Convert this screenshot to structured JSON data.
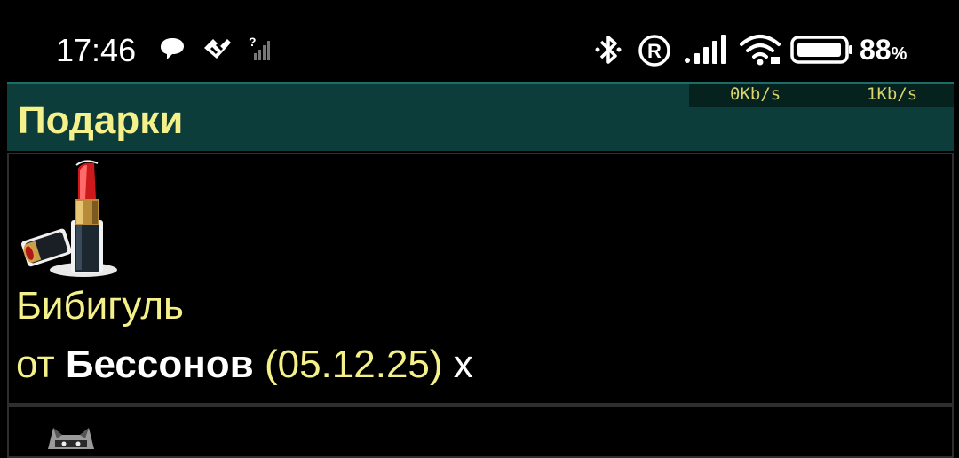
{
  "status_bar": {
    "time": "17:46",
    "battery_percent": "88",
    "battery_unit": "%",
    "icons": [
      "chat-bubble-icon",
      "app-notification-icon",
      "no-signal-sim-icon",
      "bluetooth-icon",
      "registered-icon",
      "signal-icon",
      "wifi-icon",
      "battery-icon"
    ]
  },
  "header": {
    "title": "Подарки",
    "net_down": "0Kb/s",
    "net_up": "1Kb/s"
  },
  "gifts": [
    {
      "image_icon": "lipstick-icon",
      "name": "Бибигуль",
      "from_prefix": "от ",
      "sender": "Бессонов",
      "date": " (05.12.25) ",
      "delete_label": "x"
    },
    {
      "image_icon": "raccoon-icon"
    }
  ],
  "colors": {
    "header_bg": "#0d3d3a",
    "title_yellow": "#f4f08a",
    "background": "#000000"
  }
}
